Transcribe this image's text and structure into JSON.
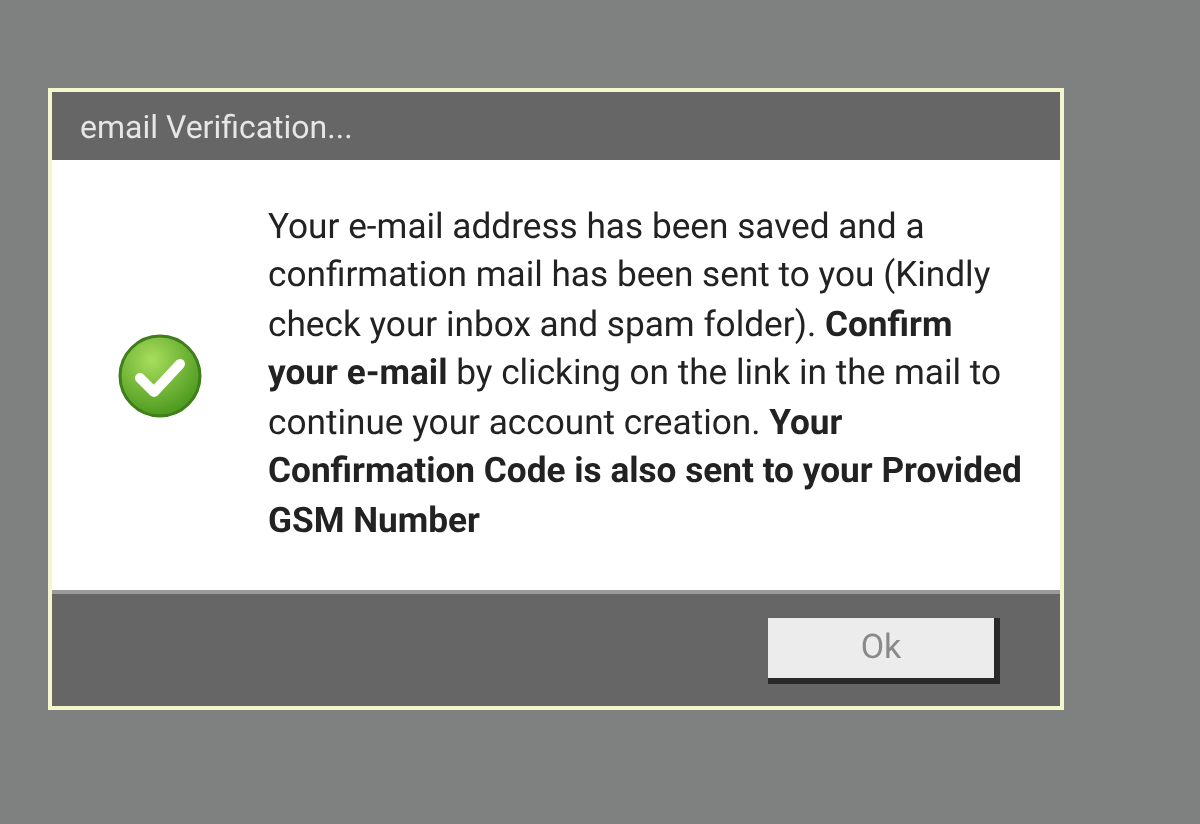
{
  "dialog": {
    "title": "email Verification...",
    "message": "Your e-mail address has been saved and a confirmation mail has been sent to you (Kindly check your inbox and spam folder). **Confirm your e-mail** by clicking on the link in the mail to continue your account creation. **Your Confirmation Code is also sent to your Provided GSM Number**",
    "buttons": [
      "Ok"
    ]
  }
}
